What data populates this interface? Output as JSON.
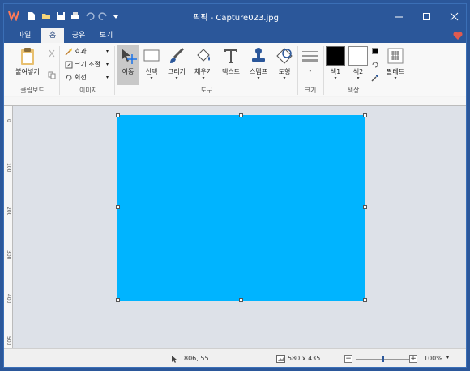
{
  "window": {
    "title": "픽픽 - Capture023.jpg",
    "accent_color": "#2b579a",
    "canvas_color": "#00b4ff"
  },
  "tabs": [
    {
      "label": "파일"
    },
    {
      "label": "홈"
    },
    {
      "label": "공유"
    },
    {
      "label": "보기"
    }
  ],
  "ribbon": {
    "clipboard": {
      "paste_label": "붙여넣기",
      "group_label": "클립보드"
    },
    "image": {
      "effect_label": "효과",
      "resize_label": "크기 조절",
      "rotate_label": "회전",
      "group_label": "이미지"
    },
    "tools": {
      "items": [
        {
          "label": "이동",
          "icon": "move-icon"
        },
        {
          "label": "선택",
          "icon": "select-icon"
        },
        {
          "label": "그리기",
          "icon": "brush-icon"
        },
        {
          "label": "채우기",
          "icon": "fill-bucket-icon"
        },
        {
          "label": "텍스트",
          "icon": "text-icon"
        },
        {
          "label": "스탬프",
          "icon": "stamp-icon"
        },
        {
          "label": "도형",
          "icon": "shape-icon"
        }
      ],
      "group_label": "도구"
    },
    "size": {
      "value": "-",
      "group_label": "크기"
    },
    "color": {
      "color1_label": "색1",
      "color2_label": "색2",
      "group_label": "색상",
      "color1": "#000000",
      "color2": "#ffffff"
    },
    "palette": {
      "label": "팔레트"
    }
  },
  "ruler": {
    "vertical_ticks": [
      "0",
      "100",
      "200",
      "300",
      "400",
      "500"
    ]
  },
  "status": {
    "cursor_position": "806, 55",
    "image_size": "580 x 435",
    "zoom_level": "100%",
    "zoom_fraction": 0.5
  }
}
